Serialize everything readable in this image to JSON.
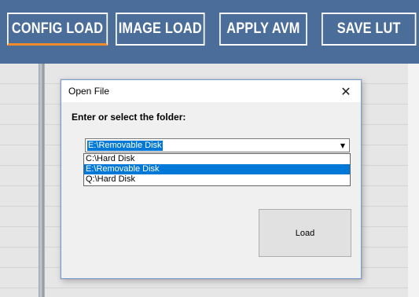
{
  "toolbar": {
    "buttons": [
      {
        "label": "CONFIG LOAD",
        "active": true
      },
      {
        "label": "IMAGE LOAD",
        "active": false
      },
      {
        "label": "APPLY AVM",
        "active": false
      },
      {
        "label": "SAVE LUT",
        "active": false
      }
    ],
    "colors": {
      "background": "#4a6d99",
      "active_underline": "#f08a2a"
    }
  },
  "dialog": {
    "title": "Open File",
    "close_glyph": "✕",
    "close_icon": "close-icon",
    "prompt": "Enter or select the folder:",
    "folder_combo": {
      "value": "E:\\Removable Disk",
      "arrow_icon": "chevron-down-icon",
      "arrow_glyph": "▼",
      "options": [
        {
          "label": "C:\\Hard Disk",
          "selected": false
        },
        {
          "label": "E:\\Removable Disk",
          "selected": true
        },
        {
          "label": "Q:\\Hard Disk",
          "selected": false
        }
      ]
    },
    "load_label": "Load"
  },
  "colors": {
    "selection": "#0078d7"
  }
}
